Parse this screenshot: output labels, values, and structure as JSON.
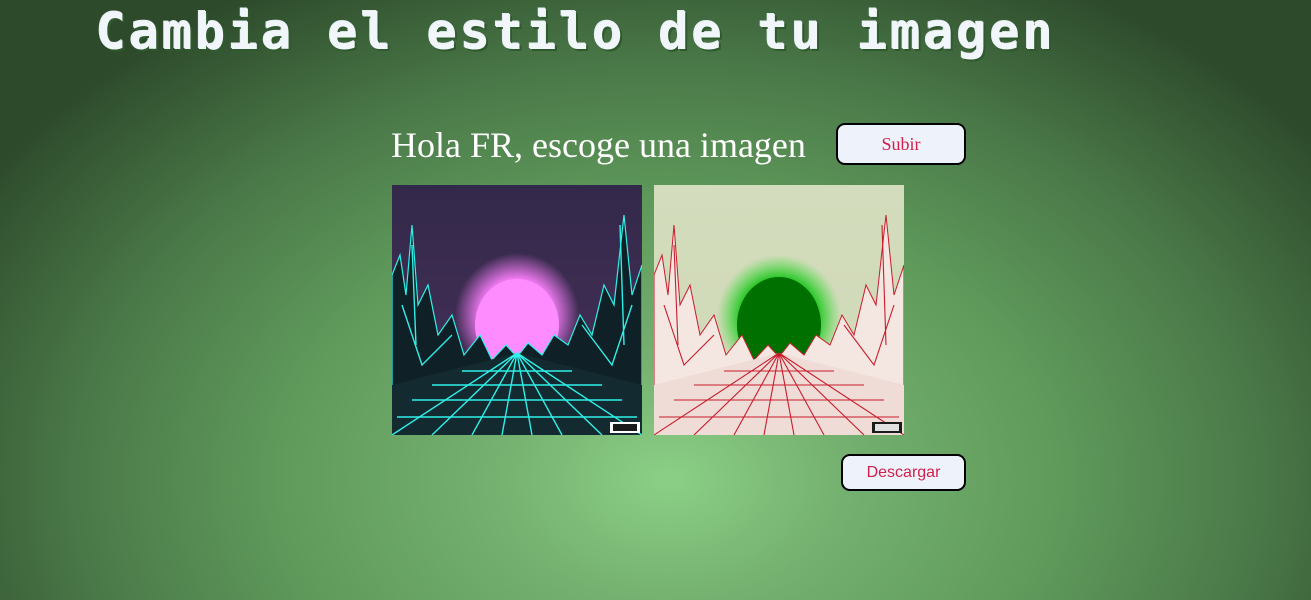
{
  "header": {
    "title": "Cambia el estilo de tu imagen"
  },
  "upload": {
    "greeting": "Hola FR, escoge una imagen",
    "button_label": "Subir"
  },
  "images": {
    "original": {
      "description_icon": "synthwave-landscape-image",
      "colors": {
        "sky": "#3a2a4e",
        "sun": "#ff88ff",
        "grid": "#2ff0e8",
        "ground": "#0d1d22"
      }
    },
    "styled": {
      "description_icon": "styled-landscape-image",
      "colors": {
        "sky": "#d4ddbb",
        "sun": "#007a00",
        "grid": "#cc1b2a",
        "ground": "#f3e5df"
      }
    }
  },
  "download": {
    "button_label": "Descargar"
  },
  "theme": {
    "background_center": "#8bcf86",
    "background_edge": "#2d4a2b",
    "button_text": "#d21f4a",
    "button_bg": "#eef3fb"
  }
}
